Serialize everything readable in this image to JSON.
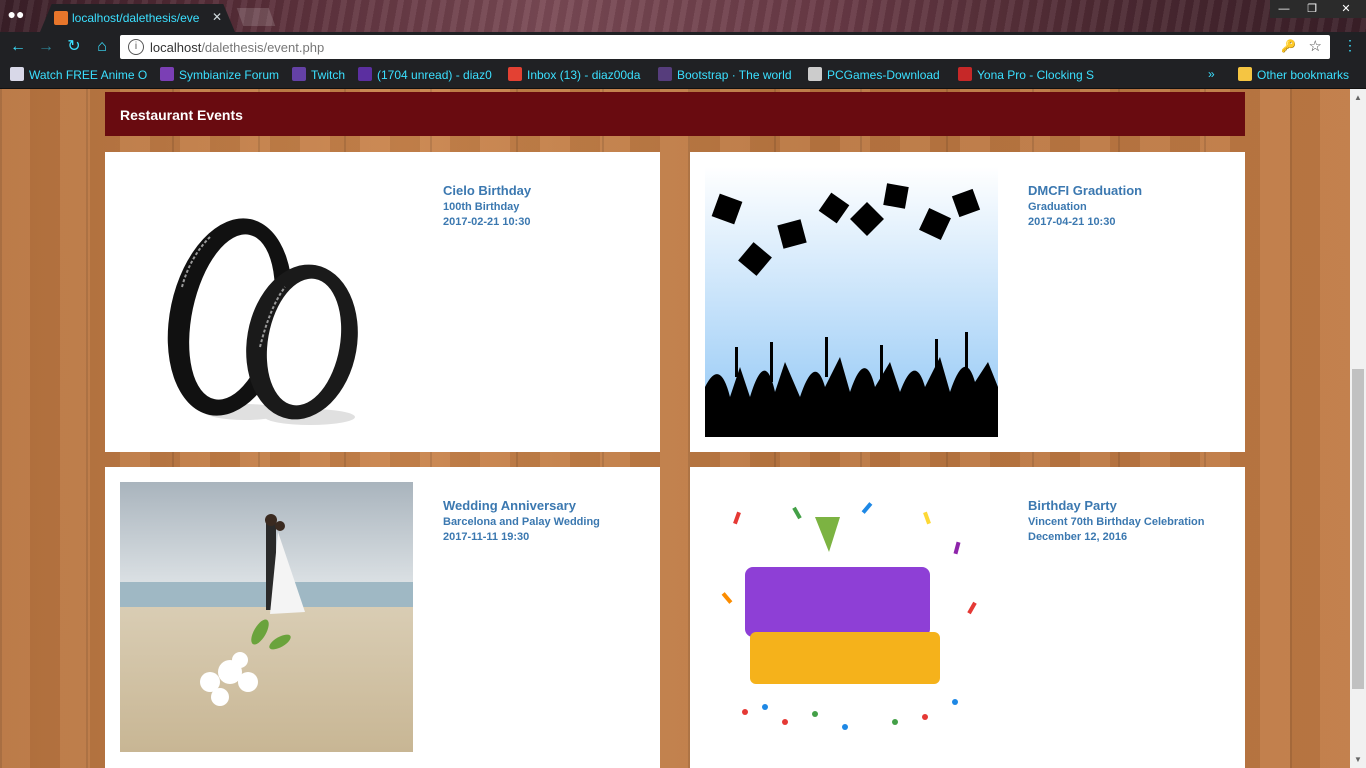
{
  "browser": {
    "tab_title": "localhost/dalethesis/eve",
    "url_host": "localhost",
    "url_path": "/dalethesis/event.php",
    "accent_color": "#3be0ff",
    "bookmarks": [
      {
        "label": "Watch FREE Anime On",
        "icon": "anime-icon",
        "color": "#d8d8e8"
      },
      {
        "label": "Symbianize Forum",
        "icon": "symbianize-icon",
        "color": "#7b3fb5"
      },
      {
        "label": "Twitch",
        "icon": "twitch-icon",
        "color": "#6441a5"
      },
      {
        "label": "(1704 unread) - diaz0",
        "icon": "yahoo-mail-icon",
        "color": "#5b2fa0"
      },
      {
        "label": "Inbox (13) - diaz00da",
        "icon": "gmail-icon",
        "color": "#e34133"
      },
      {
        "label": "Bootstrap · The world",
        "icon": "bootstrap-icon",
        "color": "#563d7c"
      },
      {
        "label": "PCGames-Download",
        "icon": "pcgames-icon",
        "color": "#ccc"
      },
      {
        "label": "Yona Pro - Clocking S",
        "icon": "yona-icon",
        "color": "#c62828"
      }
    ],
    "more_label": "»",
    "other_bookmarks": "Other bookmarks"
  },
  "page": {
    "section_title": "Restaurant Events",
    "header_color": "#690b10",
    "text_color": "#3b78b0",
    "events": [
      {
        "name": "Cielo Birthday",
        "description": "100th Birthday",
        "date": "2017-02-21 10:30",
        "image": "rings-image"
      },
      {
        "name": "DMCFI Graduation",
        "description": "Graduation",
        "date": "2017-04-21 10:30",
        "image": "graduation-image"
      },
      {
        "name": "Wedding Anniversary",
        "description": "Barcelona and Palay Wedding",
        "date": "2017-11-11 19:30",
        "image": "beach-wedding-image"
      },
      {
        "name": "Birthday Party",
        "description": "Vincent 70th Birthday Celebration",
        "date": "December 12, 2016",
        "image": "happy-birthday-image"
      }
    ]
  }
}
